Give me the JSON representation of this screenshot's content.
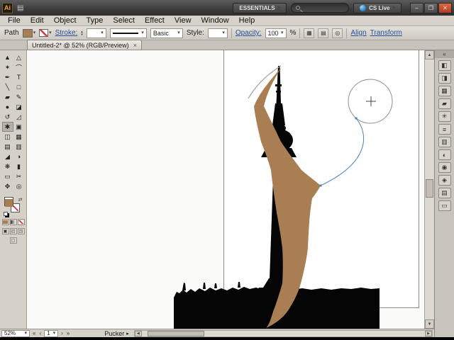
{
  "titlebar": {
    "app_initials": "Ai",
    "workspace_label": "ESSENTIALS",
    "cs_live_label": "CS Live",
    "min_glyph": "–",
    "max_glyph": "❐",
    "close_glyph": "✕"
  },
  "menu_bar": {
    "items": [
      "File",
      "Edit",
      "Object",
      "Type",
      "Select",
      "Effect",
      "View",
      "Window",
      "Help"
    ]
  },
  "control_bar": {
    "context_label": "Path",
    "stroke_label": "Stroke:",
    "brush_value": "Basic",
    "style_label": "Style:",
    "opacity_label": "Opacity:",
    "opacity_value": "100",
    "opacity_unit": "%",
    "align_label": "Align",
    "transform_label": "Transform"
  },
  "tab_bar": {
    "title": "Untitled-2* @ 52% (RGB/Preview)",
    "close_glyph": "×"
  },
  "toolbar": {
    "swap_glyph": "⇄",
    "screen_mode_glyph": "▢",
    "draw_modes": [
      {
        "name": "draw-normal",
        "glyph": "▣"
      },
      {
        "name": "draw-behind",
        "glyph": "◰"
      },
      {
        "name": "draw-inside",
        "glyph": "◳"
      }
    ],
    "tools": [
      {
        "name": "selection-tool",
        "glyph": "▲"
      },
      {
        "name": "direct-selection-tool",
        "glyph": "△"
      },
      {
        "name": "magic-wand-tool",
        "glyph": "✶"
      },
      {
        "name": "lasso-tool",
        "glyph": "⌒"
      },
      {
        "name": "pen-tool",
        "glyph": "✒"
      },
      {
        "name": "type-tool",
        "glyph": "T"
      },
      {
        "name": "line-segment-tool",
        "glyph": "╲"
      },
      {
        "name": "rectangle-tool",
        "glyph": "□"
      },
      {
        "name": "paintbrush-tool",
        "glyph": "▰"
      },
      {
        "name": "pencil-tool",
        "glyph": "✎"
      },
      {
        "name": "blob-brush-tool",
        "glyph": "●"
      },
      {
        "name": "eraser-tool",
        "glyph": "◪"
      },
      {
        "name": "rotate-tool",
        "glyph": "↺"
      },
      {
        "name": "scale-tool",
        "glyph": "◿"
      },
      {
        "name": "pucker-tool",
        "glyph": "✱"
      },
      {
        "name": "free-transform-tool",
        "glyph": "▣"
      },
      {
        "name": "shape-builder-tool",
        "glyph": "◫"
      },
      {
        "name": "perspective-grid-tool",
        "glyph": "▦"
      },
      {
        "name": "mesh-tool",
        "glyph": "▤"
      },
      {
        "name": "gradient-tool",
        "glyph": "▥"
      },
      {
        "name": "eyedropper-tool",
        "glyph": "◢"
      },
      {
        "name": "blend-tool",
        "glyph": "◑"
      },
      {
        "name": "symbol-sprayer-tool",
        "glyph": "❋"
      },
      {
        "name": "column-graph-tool",
        "glyph": "▮"
      },
      {
        "name": "artboard-tool",
        "glyph": "▭"
      },
      {
        "name": "slice-tool",
        "glyph": "✂"
      },
      {
        "name": "hand-tool",
        "glyph": "✥"
      },
      {
        "name": "zoom-tool",
        "glyph": "◎"
      }
    ]
  },
  "dock": {
    "collapse_glyph": "«",
    "panels": [
      {
        "name": "color-panel",
        "glyph": "◧"
      },
      {
        "name": "color-guide-panel",
        "glyph": "◨"
      },
      {
        "name": "swatches-panel",
        "glyph": "▦"
      },
      {
        "name": "brushes-panel",
        "glyph": "▰"
      },
      {
        "name": "symbols-panel",
        "glyph": "✳"
      },
      {
        "name": "stroke-panel",
        "glyph": "≡"
      },
      {
        "name": "gradient-panel",
        "glyph": "▥"
      },
      {
        "name": "transparency-panel",
        "glyph": "◐"
      },
      {
        "name": "appearance-panel",
        "glyph": "◉"
      },
      {
        "name": "graphic-styles-panel",
        "glyph": "◈"
      },
      {
        "name": "layers-panel",
        "glyph": "▤"
      },
      {
        "name": "artboards-panel",
        "glyph": "▭"
      }
    ]
  },
  "status_bar": {
    "zoom_value": "52%",
    "nav_first": "«",
    "nav_prev": "‹",
    "artboard_value": "1",
    "nav_next": "›",
    "nav_last": "»",
    "tool_status": "Pucker",
    "popup_glyph": "▸"
  },
  "ui": {
    "dropdown": "▾",
    "spin_up": "▴",
    "spin_down": "▾",
    "scroll_up": "▲",
    "scroll_down": "▼",
    "scroll_left": "◀",
    "scroll_right": "▶"
  },
  "colors": {
    "fill_brown": "#a87e52",
    "silhouette": "#050505",
    "pen_blue": "#4a7fc1",
    "circle_gray": "#8f8f8f",
    "edge_gray": "#9aa0a8"
  }
}
